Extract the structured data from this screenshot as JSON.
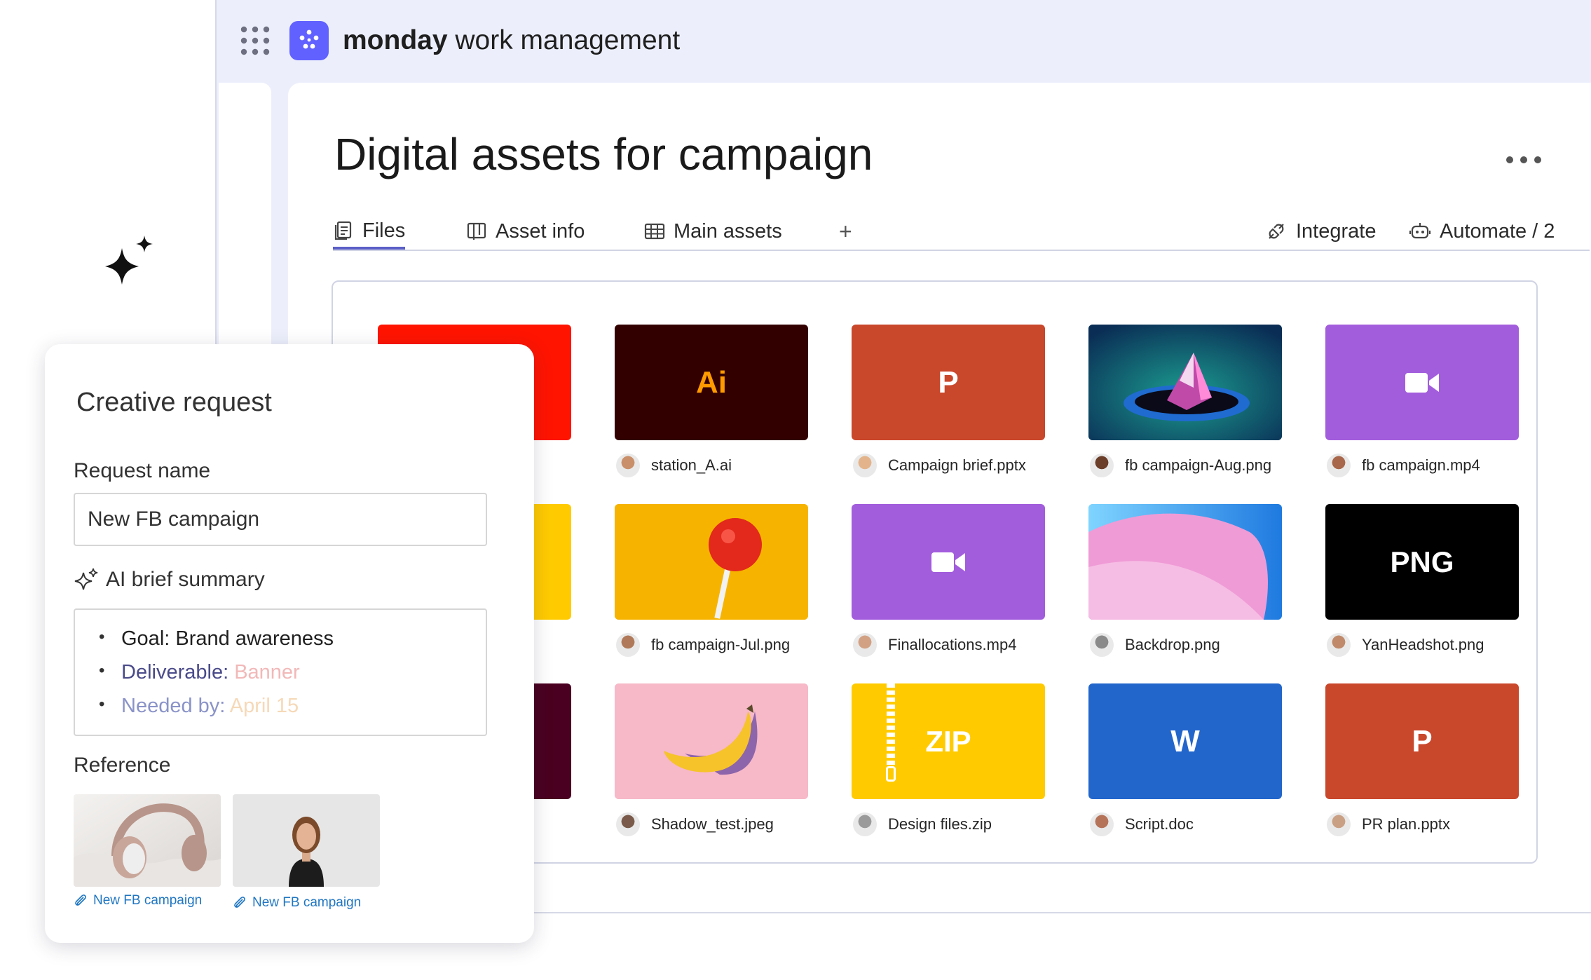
{
  "app": {
    "brand_bold": "monday",
    "brand_light": " work management"
  },
  "board": {
    "title": "Digital assets for campaign",
    "tabs": [
      {
        "label": "Files",
        "icon": "files-icon",
        "active": true
      },
      {
        "label": "Asset info",
        "icon": "kanban-icon",
        "active": false
      },
      {
        "label": "Main assets",
        "icon": "table-icon",
        "active": false
      }
    ],
    "add_tab": "+",
    "integrate_label": "Integrate",
    "automate_label": "Automate / 2"
  },
  "files": [
    {
      "name": "station_A.ai",
      "thumb_text": "Ai",
      "thumb_color": "#330000",
      "text_color": "#ff9a00"
    },
    {
      "name": "Campaign brief.pptx",
      "thumb_text": "P",
      "thumb_color": "#c9472b"
    },
    {
      "name": "fb campaign-Aug.png",
      "thumb_color": "#0f6b6a"
    },
    {
      "name": "fb campaign.mp4",
      "thumb_color": "#a25ddc",
      "icon": "video-camera-icon"
    },
    {
      "name": "fb campaign-Jul.png",
      "thumb_color": "#f6b400"
    },
    {
      "name": "Finallocations.mp4",
      "thumb_color": "#a25ddc",
      "icon": "video-camera-icon"
    },
    {
      "name": "Backdrop.png",
      "thumb_color": "#5bb8ee"
    },
    {
      "name": "YanHeadshot.png",
      "thumb_text": "PNG",
      "thumb_color": "#000000"
    },
    {
      "name": "Shadow_test.jpeg",
      "thumb_color": "#f7b8c8"
    },
    {
      "name": "Design files.zip",
      "thumb_text": "ZIP",
      "thumb_color": "#ffcb00",
      "icon": "zipper-icon"
    },
    {
      "name": "Script.doc",
      "thumb_text": "W",
      "thumb_color": "#2266cc"
    },
    {
      "name": "PR plan.pptx",
      "thumb_text": "P",
      "thumb_color": "#c9472b"
    }
  ],
  "partial_tiles": [
    {
      "thumb_color": "#ff1400"
    },
    {
      "thumb_color": "#ffcb00"
    },
    {
      "thumb_color": "#4a0020"
    }
  ],
  "request_panel": {
    "title": "Creative request",
    "request_name_label": "Request name",
    "request_name_value": "New FB campaign",
    "ai_summary_label": "AI brief summary",
    "summary": {
      "goal_label": "Goal: ",
      "goal_value": "Brand awareness",
      "deliverable_label": "Deliverable: ",
      "deliverable_value": "Banner",
      "needed_label": "Needed by: ",
      "needed_value": "April 15"
    },
    "reference_label": "Reference",
    "references": [
      {
        "link": "New FB campaign",
        "image": "headphones-photo"
      },
      {
        "link": "New FB campaign",
        "image": "portrait-photo"
      }
    ]
  },
  "colors": {
    "accent": "#6161ff",
    "link": "#1f76c2",
    "tab_underline": "#5b5fc7"
  }
}
